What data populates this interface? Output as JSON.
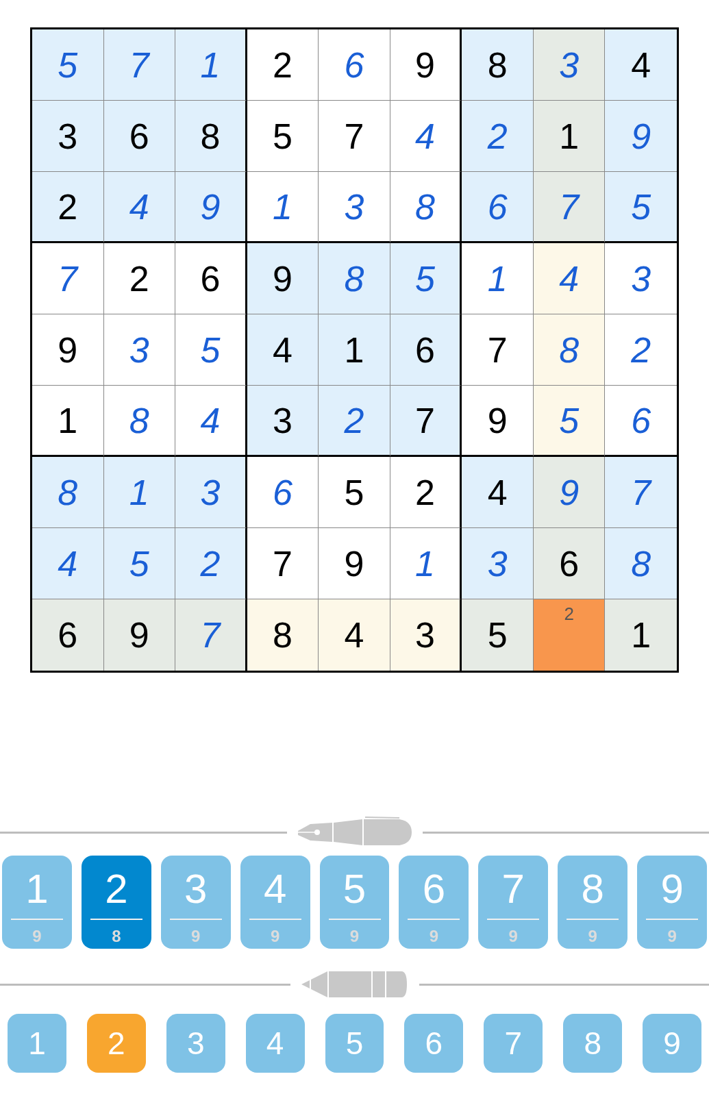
{
  "grid": [
    [
      {
        "v": "5",
        "entered": true,
        "highlighted": false,
        "selected": false
      },
      {
        "v": "7",
        "entered": true,
        "highlighted": false,
        "selected": false
      },
      {
        "v": "1",
        "entered": true,
        "highlighted": false,
        "selected": false
      },
      {
        "v": "2",
        "entered": false,
        "highlighted": false,
        "selected": false
      },
      {
        "v": "6",
        "entered": true,
        "highlighted": false,
        "selected": false
      },
      {
        "v": "9",
        "entered": false,
        "highlighted": false,
        "selected": false
      },
      {
        "v": "8",
        "entered": false,
        "highlighted": false,
        "selected": false
      },
      {
        "v": "3",
        "entered": true,
        "highlighted": true,
        "selected": false
      },
      {
        "v": "4",
        "entered": false,
        "highlighted": false,
        "selected": false
      }
    ],
    [
      {
        "v": "3",
        "entered": false,
        "highlighted": false,
        "selected": false
      },
      {
        "v": "6",
        "entered": false,
        "highlighted": false,
        "selected": false
      },
      {
        "v": "8",
        "entered": false,
        "highlighted": false,
        "selected": false
      },
      {
        "v": "5",
        "entered": false,
        "highlighted": false,
        "selected": false
      },
      {
        "v": "7",
        "entered": false,
        "highlighted": false,
        "selected": false
      },
      {
        "v": "4",
        "entered": true,
        "highlighted": false,
        "selected": false
      },
      {
        "v": "2",
        "entered": true,
        "highlighted": false,
        "selected": false
      },
      {
        "v": "1",
        "entered": false,
        "highlighted": true,
        "selected": false
      },
      {
        "v": "9",
        "entered": true,
        "highlighted": false,
        "selected": false
      }
    ],
    [
      {
        "v": "2",
        "entered": false,
        "highlighted": false,
        "selected": false
      },
      {
        "v": "4",
        "entered": true,
        "highlighted": false,
        "selected": false
      },
      {
        "v": "9",
        "entered": true,
        "highlighted": false,
        "selected": false
      },
      {
        "v": "1",
        "entered": true,
        "highlighted": false,
        "selected": false
      },
      {
        "v": "3",
        "entered": true,
        "highlighted": false,
        "selected": false
      },
      {
        "v": "8",
        "entered": true,
        "highlighted": false,
        "selected": false
      },
      {
        "v": "6",
        "entered": true,
        "highlighted": false,
        "selected": false
      },
      {
        "v": "7",
        "entered": true,
        "highlighted": true,
        "selected": false
      },
      {
        "v": "5",
        "entered": true,
        "highlighted": false,
        "selected": false
      }
    ],
    [
      {
        "v": "7",
        "entered": true,
        "highlighted": false,
        "selected": false
      },
      {
        "v": "2",
        "entered": false,
        "highlighted": false,
        "selected": false
      },
      {
        "v": "6",
        "entered": false,
        "highlighted": false,
        "selected": false
      },
      {
        "v": "9",
        "entered": false,
        "highlighted": false,
        "selected": false
      },
      {
        "v": "8",
        "entered": true,
        "highlighted": false,
        "selected": false
      },
      {
        "v": "5",
        "entered": true,
        "highlighted": false,
        "selected": false
      },
      {
        "v": "1",
        "entered": true,
        "highlighted": false,
        "selected": false
      },
      {
        "v": "4",
        "entered": true,
        "highlighted": true,
        "selected": false
      },
      {
        "v": "3",
        "entered": true,
        "highlighted": false,
        "selected": false
      }
    ],
    [
      {
        "v": "9",
        "entered": false,
        "highlighted": false,
        "selected": false
      },
      {
        "v": "3",
        "entered": true,
        "highlighted": false,
        "selected": false
      },
      {
        "v": "5",
        "entered": true,
        "highlighted": false,
        "selected": false
      },
      {
        "v": "4",
        "entered": false,
        "highlighted": false,
        "selected": false
      },
      {
        "v": "1",
        "entered": false,
        "highlighted": false,
        "selected": false
      },
      {
        "v": "6",
        "entered": false,
        "highlighted": false,
        "selected": false
      },
      {
        "v": "7",
        "entered": false,
        "highlighted": false,
        "selected": false
      },
      {
        "v": "8",
        "entered": true,
        "highlighted": true,
        "selected": false
      },
      {
        "v": "2",
        "entered": true,
        "highlighted": false,
        "selected": false
      }
    ],
    [
      {
        "v": "1",
        "entered": false,
        "highlighted": false,
        "selected": false
      },
      {
        "v": "8",
        "entered": true,
        "highlighted": false,
        "selected": false
      },
      {
        "v": "4",
        "entered": true,
        "highlighted": false,
        "selected": false
      },
      {
        "v": "3",
        "entered": false,
        "highlighted": false,
        "selected": false
      },
      {
        "v": "2",
        "entered": true,
        "highlighted": false,
        "selected": false
      },
      {
        "v": "7",
        "entered": false,
        "highlighted": false,
        "selected": false
      },
      {
        "v": "9",
        "entered": false,
        "highlighted": false,
        "selected": false
      },
      {
        "v": "5",
        "entered": true,
        "highlighted": true,
        "selected": false
      },
      {
        "v": "6",
        "entered": true,
        "highlighted": false,
        "selected": false
      }
    ],
    [
      {
        "v": "8",
        "entered": true,
        "highlighted": false,
        "selected": false
      },
      {
        "v": "1",
        "entered": true,
        "highlighted": false,
        "selected": false
      },
      {
        "v": "3",
        "entered": true,
        "highlighted": false,
        "selected": false
      },
      {
        "v": "6",
        "entered": true,
        "highlighted": false,
        "selected": false
      },
      {
        "v": "5",
        "entered": false,
        "highlighted": false,
        "selected": false
      },
      {
        "v": "2",
        "entered": false,
        "highlighted": false,
        "selected": false
      },
      {
        "v": "4",
        "entered": false,
        "highlighted": false,
        "selected": false
      },
      {
        "v": "9",
        "entered": true,
        "highlighted": true,
        "selected": false
      },
      {
        "v": "7",
        "entered": true,
        "highlighted": false,
        "selected": false
      }
    ],
    [
      {
        "v": "4",
        "entered": true,
        "highlighted": false,
        "selected": false
      },
      {
        "v": "5",
        "entered": true,
        "highlighted": false,
        "selected": false
      },
      {
        "v": "2",
        "entered": true,
        "highlighted": false,
        "selected": false
      },
      {
        "v": "7",
        "entered": false,
        "highlighted": false,
        "selected": false
      },
      {
        "v": "9",
        "entered": false,
        "highlighted": false,
        "selected": false
      },
      {
        "v": "1",
        "entered": true,
        "highlighted": false,
        "selected": false
      },
      {
        "v": "3",
        "entered": true,
        "highlighted": false,
        "selected": false
      },
      {
        "v": "6",
        "entered": false,
        "highlighted": true,
        "selected": false
      },
      {
        "v": "8",
        "entered": true,
        "highlighted": false,
        "selected": false
      }
    ],
    [
      {
        "v": "6",
        "entered": false,
        "highlighted": true,
        "selected": false
      },
      {
        "v": "9",
        "entered": false,
        "highlighted": true,
        "selected": false
      },
      {
        "v": "7",
        "entered": true,
        "highlighted": true,
        "selected": false
      },
      {
        "v": "8",
        "entered": false,
        "highlighted": true,
        "selected": false
      },
      {
        "v": "4",
        "entered": false,
        "highlighted": true,
        "selected": false
      },
      {
        "v": "3",
        "entered": false,
        "highlighted": true,
        "selected": false
      },
      {
        "v": "5",
        "entered": false,
        "highlighted": true,
        "selected": false
      },
      {
        "notes": [
          "2"
        ],
        "selected": true
      },
      {
        "v": "1",
        "entered": false,
        "highlighted": true,
        "selected": false
      }
    ]
  ],
  "pen_buttons": [
    {
      "digit": "1",
      "count": "9",
      "selected": false
    },
    {
      "digit": "2",
      "count": "8",
      "selected": true
    },
    {
      "digit": "3",
      "count": "9",
      "selected": false
    },
    {
      "digit": "4",
      "count": "9",
      "selected": false
    },
    {
      "digit": "5",
      "count": "9",
      "selected": false
    },
    {
      "digit": "6",
      "count": "9",
      "selected": false
    },
    {
      "digit": "7",
      "count": "9",
      "selected": false
    },
    {
      "digit": "8",
      "count": "9",
      "selected": false
    },
    {
      "digit": "9",
      "count": "9",
      "selected": false
    }
  ],
  "pencil_buttons": [
    {
      "digit": "1",
      "selected": false
    },
    {
      "digit": "2",
      "selected": true
    },
    {
      "digit": "3",
      "selected": false
    },
    {
      "digit": "4",
      "selected": false
    },
    {
      "digit": "5",
      "selected": false
    },
    {
      "digit": "6",
      "selected": false
    },
    {
      "digit": "7",
      "selected": false
    },
    {
      "digit": "8",
      "selected": false
    },
    {
      "digit": "9",
      "selected": false
    }
  ]
}
